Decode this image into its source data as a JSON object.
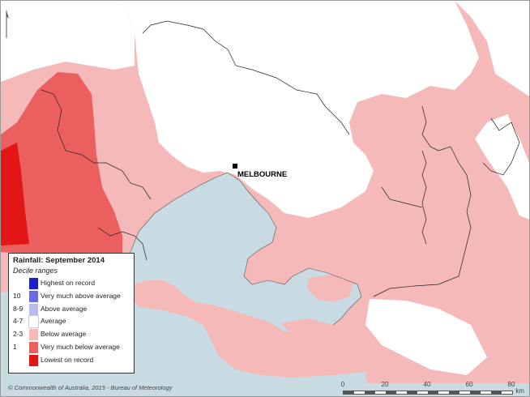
{
  "map": {
    "legend_title": "Rainfall: September 2014",
    "legend_subtitle": "Decile ranges",
    "legend_items": [
      {
        "code": "",
        "label": "Highest on record",
        "color": "#1e1ecf"
      },
      {
        "code": "10",
        "label": "Very much above average",
        "color": "#6b6be0"
      },
      {
        "code": "8-9",
        "label": "Above average",
        "color": "#b9b9ef"
      },
      {
        "code": "4-7",
        "label": "Average",
        "color": "#ffffff"
      },
      {
        "code": "2-3",
        "label": "Below average",
        "color": "#f5b9b9"
      },
      {
        "code": "1",
        "label": "Very much below average",
        "color": "#ec5f5f"
      },
      {
        "code": "",
        "label": "Lowest on record",
        "color": "#e21616"
      }
    ],
    "city": "MELBOURNE",
    "copyright": "© Commonwealth of Australia, 2015 - Bureau of Meteorology",
    "scale": {
      "ticks": [
        "0",
        "20",
        "40",
        "60",
        "80"
      ],
      "unit": "km"
    },
    "colors": {
      "water": "#c9dbe2",
      "below": "#f5b9b9",
      "very_below": "#ec5f5f",
      "lowest": "#e21616",
      "average": "#ffffff"
    }
  }
}
